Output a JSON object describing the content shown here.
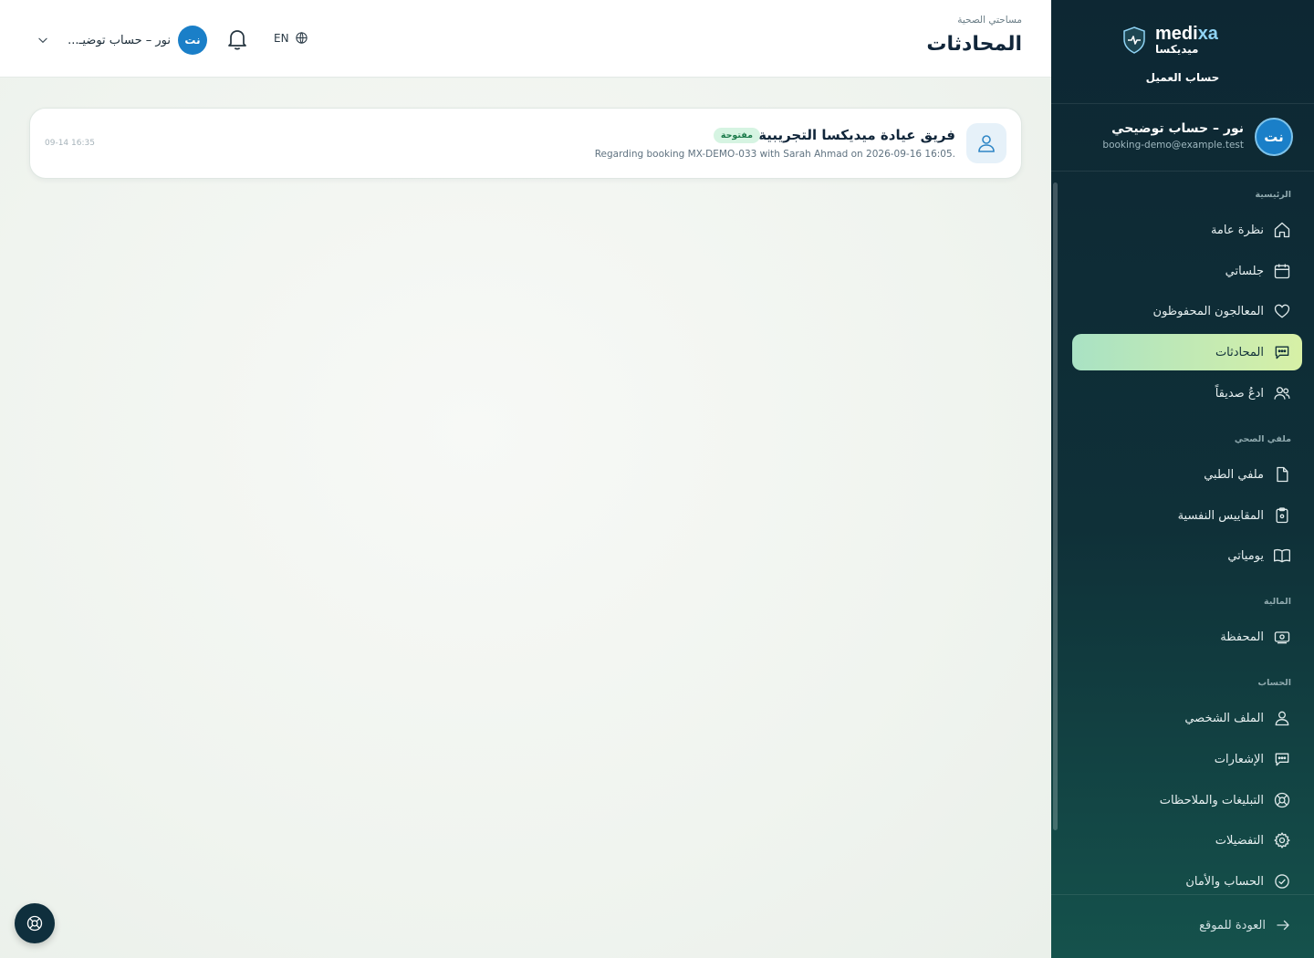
{
  "brand": {
    "name_en_prefix": "medi",
    "name_en_suffix": "xa",
    "name_ar": "ميديكسا",
    "subtitle": "حساب العميل"
  },
  "user": {
    "initials": "نت",
    "name": "نور – حساب توضيحي",
    "email": "booking-demo@example.test",
    "menu_name": "نور – حساب توضيـ..."
  },
  "sidebar": {
    "sections": [
      {
        "label": "الرئيسية",
        "items": [
          {
            "label": "نظرة عامة",
            "icon": "home-icon"
          },
          {
            "label": "جلساتي",
            "icon": "calendar-icon"
          },
          {
            "label": "المعالجون المحفوظون",
            "icon": "heart-icon"
          },
          {
            "label": "المحادثات",
            "icon": "chat-icon",
            "active": true
          },
          {
            "label": "ادعُ صديقاً",
            "icon": "users-icon"
          }
        ]
      },
      {
        "label": "ملفي الصحي",
        "items": [
          {
            "label": "ملفي الطبي",
            "icon": "file-icon"
          },
          {
            "label": "المقاييس النفسية",
            "icon": "clipboard-icon"
          },
          {
            "label": "يومياتي",
            "icon": "book-icon"
          }
        ]
      },
      {
        "label": "المالية",
        "items": [
          {
            "label": "المحفظة",
            "icon": "wallet-icon"
          }
        ]
      },
      {
        "label": "الحساب",
        "items": [
          {
            "label": "الملف الشخصي",
            "icon": "user-icon"
          },
          {
            "label": "الإشعارات",
            "icon": "message-icon"
          },
          {
            "label": "التبليغات والملاحظات",
            "icon": "lifebuoy-icon"
          },
          {
            "label": "التفضيلات",
            "icon": "gear-icon"
          },
          {
            "label": "الحساب والأمان",
            "icon": "check-circle-icon"
          }
        ]
      }
    ],
    "footer_label": "العودة للموقع"
  },
  "topbar": {
    "breadcrumb": "مساحتي الصحية",
    "title": "المحادثات",
    "lang_label": "EN"
  },
  "conversations": [
    {
      "title": "فريق عيادة ميديكسا التجريبية",
      "status": "مفتوحة",
      "subtitle": "Regarding booking MX-DEMO-033 with Sarah Ahmad on 2026-09-16 16:05.",
      "time": "09-14 16:35"
    }
  ],
  "colors": {
    "sidebar_bg": "#0d2733",
    "active_item": "#c8ecb4",
    "accent_blue": "#1a7fc8",
    "badge_green": "#1b7a4a"
  }
}
